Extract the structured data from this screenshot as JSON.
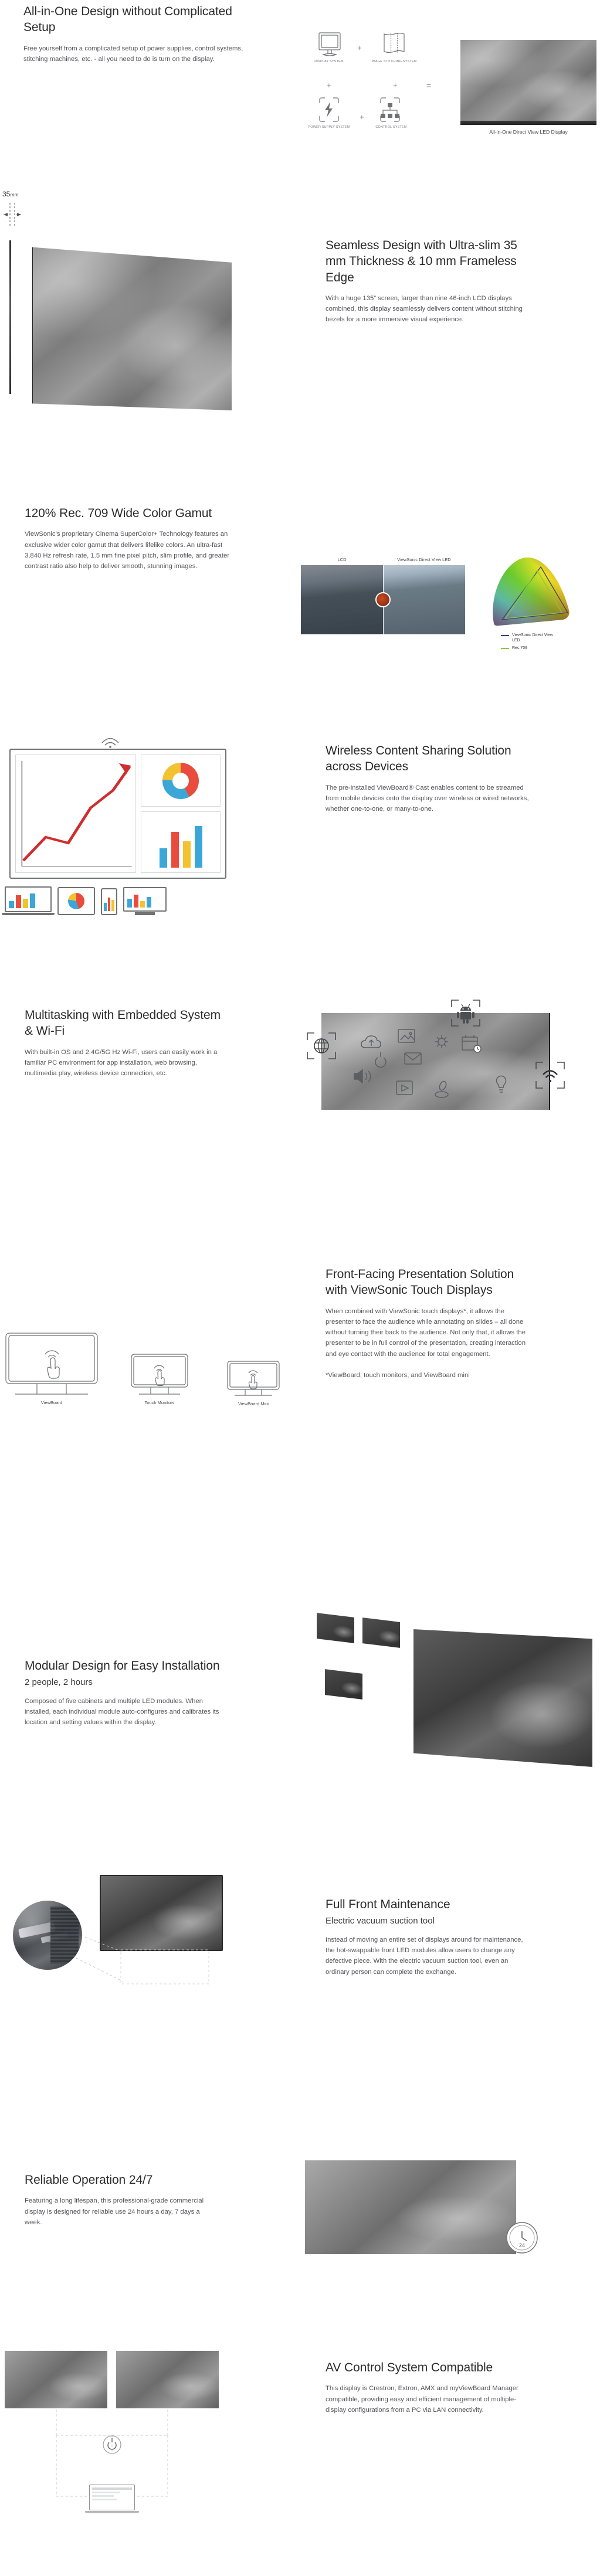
{
  "sections": [
    {
      "id": "all-in-one",
      "title": "All-in-One Design without Complicated Setup",
      "body": "Free yourself from a complicated setup of power supplies, control systems, stitching machines, etc. - all you need to do is turn on the display.",
      "diagram": {
        "items": [
          {
            "label": "DISPLAY SYSTEM",
            "icon": "monitor-icon"
          },
          {
            "label": "IMAGE STITCHING SYSTEM",
            "icon": "stitching-icon"
          },
          {
            "label": "POWER SUPPLY SYSTEM",
            "icon": "bolt-icon"
          },
          {
            "label": "CONTROL SYSTEM",
            "icon": "network-icon"
          }
        ],
        "operators": [
          "+",
          "+",
          "+",
          "+",
          "="
        ],
        "result_caption": "All-in-One Direct View LED Display"
      }
    },
    {
      "id": "seamless-design",
      "title": "Seamless Design with Ultra-slim 35 mm Thickness & 10 mm Frameless Edge",
      "body": "With a huge 135” screen, larger than nine 46-inch LCD displays combined, this display seamlessly delivers content without stitching bezels for a more immersive visual experience.",
      "dimension_label": "35",
      "dimension_unit": "mm"
    },
    {
      "id": "color-gamut",
      "title": "120% Rec. 709 Wide Color Gamut",
      "body": "ViewSonic’s proprietary Cinema SuperColor+ Technology features an exclusive wider color gamut that delivers lifelike colors. An ultra-fast 3,840 Hz refresh rate, 1.5 mm fine pixel pitch, slim profile, and greater contrast ratio also help to deliver smooth, stunning images.",
      "compare": {
        "left_label": "LCD",
        "right_label": "ViewSonic Direct View LED"
      },
      "gamut_legend": [
        {
          "name": "ViewSonic Direct View LED",
          "color": "#3b3f75"
        },
        {
          "name": "Rec.709",
          "color": "#8dc63f"
        }
      ]
    },
    {
      "id": "wireless-sharing",
      "title": "Wireless Content Sharing Solution across Devices",
      "body": "The pre-installed ViewBoard® Cast enables content to be streamed from mobile devices onto the display over wireless or wired networks, whether one-to-one, or many-to-one.",
      "chart_colors": {
        "line": "#cf2e2e",
        "donut_a": "#e94b3c",
        "donut_b": "#3aa7d8",
        "donut_c": "#f2c230",
        "bar_blue": "#3aa7d8",
        "bar_red": "#e94b3c",
        "bar_yellow": "#f2c230"
      }
    },
    {
      "id": "multitasking",
      "title": "Multitasking with Embedded System & Wi-Fi",
      "body": "With built-in OS and 2.4G/5G Hz Wi-Fi, users can easily work in a familiar PC environment for app installation, web browsing, multimedia play, wireless device connection, etc.",
      "icons": [
        "android-icon",
        "globe-icon",
        "wifi-icon",
        "cloud-upload-icon",
        "image-icon",
        "gear-icon",
        "calendar-clock-icon",
        "power-icon",
        "mail-icon",
        "speaker-icon",
        "play-icon",
        "mouse-icon",
        "lightbulb-icon"
      ]
    },
    {
      "id": "front-facing",
      "title": "Front-Facing Presentation Solution with ViewSonic Touch Displays",
      "body": "When combined with ViewSonic touch displays*, it allows the presenter to face the audience while annotating on slides – all done without turning their back to the audience. Not only that, it allows the presenter to be in full control of the presentation, creating interaction and eye contact with the audience for total engagement.",
      "note": "*ViewBoard, touch monitors, and ViewBoard mini",
      "device_labels": [
        "ViewBoard",
        "Touch Monitors",
        "ViewBoard Mini"
      ]
    },
    {
      "id": "modular-design",
      "title": "Modular Design for Easy Installation",
      "subtitle": "2 people, 2 hours",
      "body": "Composed of five cabinets and multiple LED modules. When installed, each individual module auto-configures and calibrates its location and setting values within the display."
    },
    {
      "id": "full-front-maintenance",
      "title": "Full Front Maintenance",
      "subtitle": "Electric vacuum suction tool",
      "body": "Instead of moving an entire set of displays around for maintenance, the hot-swappable front LED modules allow users to change any defective piece. With the electric vacuum suction tool, even an ordinary person can complete the exchange."
    },
    {
      "id": "reliable-operation",
      "title": "Reliable Operation 24/7",
      "body": "Featuring a long lifespan, this professional-grade commercial display is designed for reliable use 24 hours a day, 7 days a week.",
      "badge": "24"
    },
    {
      "id": "av-control",
      "title": "AV Control System Compatible",
      "body": "This display is Crestron, Extron, AMX and myViewBoard Manager compatible, providing easy and efficient management of multiple-display configurations from a PC via LAN connectivity."
    }
  ]
}
